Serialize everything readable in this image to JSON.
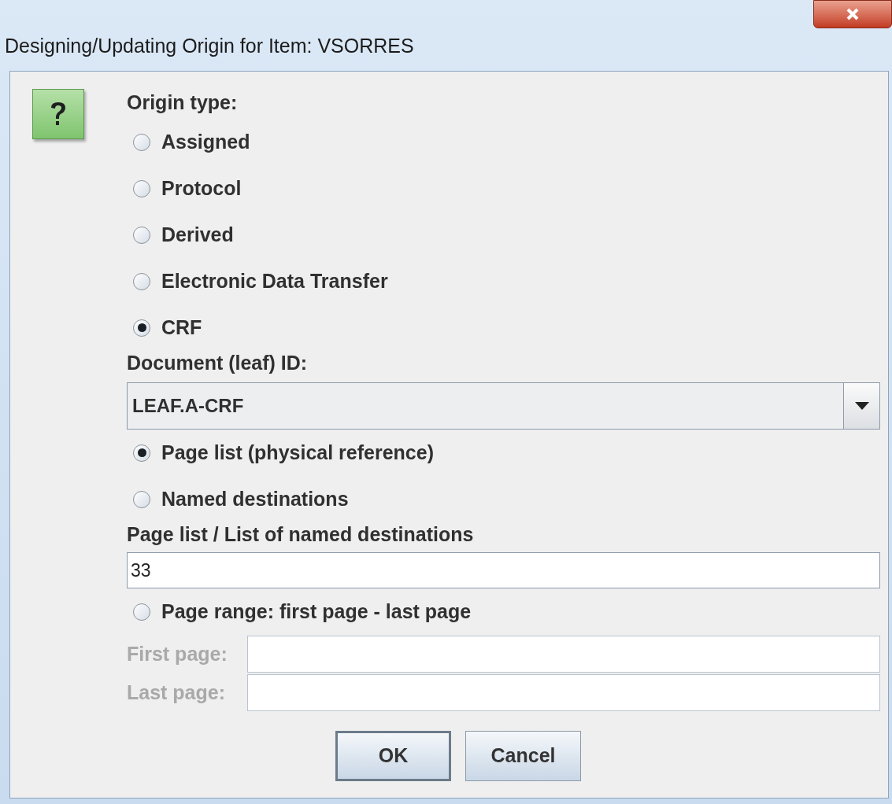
{
  "window": {
    "title": "Designing/Updating Origin for Item: VSORRES"
  },
  "origin_type": {
    "label": "Origin type:",
    "options": [
      {
        "label": "Assigned",
        "selected": false
      },
      {
        "label": "Protocol",
        "selected": false
      },
      {
        "label": "Derived",
        "selected": false
      },
      {
        "label": "Electronic Data Transfer",
        "selected": false
      },
      {
        "label": "CRF",
        "selected": true
      }
    ]
  },
  "document": {
    "label": "Document (leaf) ID:",
    "value": "LEAF.A-CRF"
  },
  "reference_options": [
    {
      "label": "Page list (physical reference)",
      "selected": true
    },
    {
      "label": "Named destinations",
      "selected": false
    }
  ],
  "page_list": {
    "label": "Page list / List of named destinations",
    "value": "33"
  },
  "page_range": {
    "label": "Page range: first page - last page",
    "selected": false,
    "fields": [
      {
        "label": "First page:",
        "disabled": true
      },
      {
        "label": "Last page:",
        "disabled": true
      }
    ]
  },
  "buttons": [
    {
      "label": "OK",
      "focused": true
    },
    {
      "label": "Cancel",
      "focused": false
    }
  ]
}
